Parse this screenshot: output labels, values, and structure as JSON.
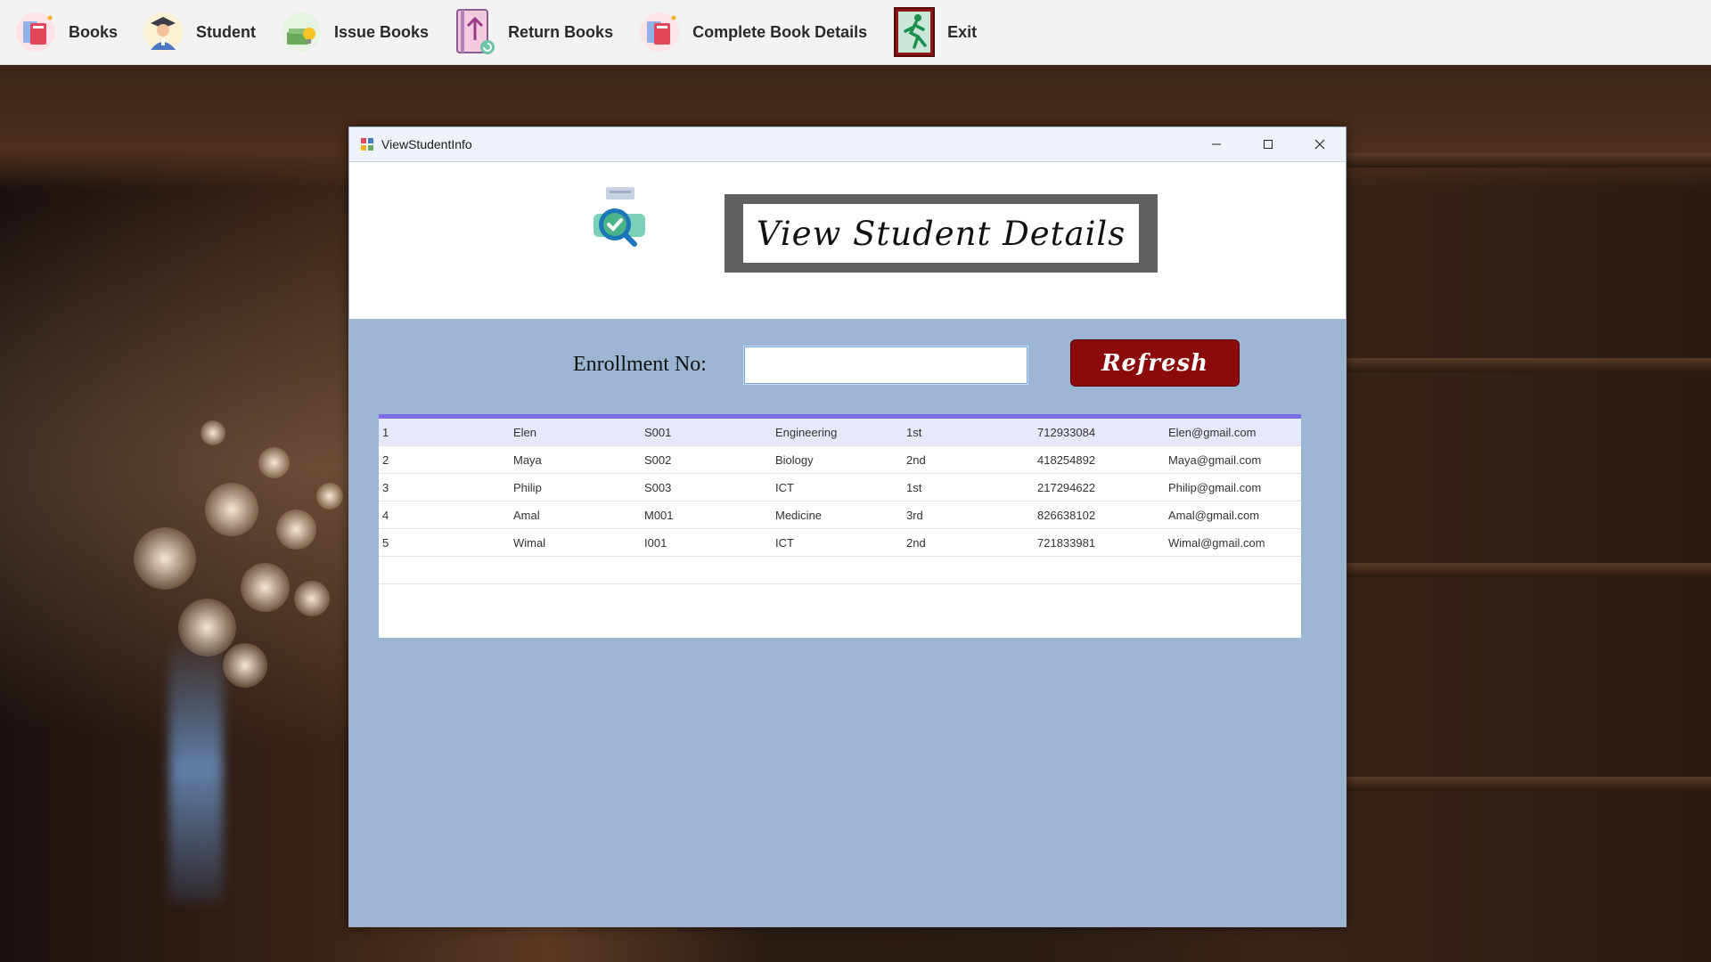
{
  "toolbar": {
    "items": [
      {
        "label": "Books",
        "icon": "books-icon"
      },
      {
        "label": "Student",
        "icon": "student-icon"
      },
      {
        "label": "Issue Books",
        "icon": "issue-books-icon"
      },
      {
        "label": "Return Books",
        "icon": "return-books-icon"
      },
      {
        "label": "Complete Book Details",
        "icon": "book-details-icon"
      },
      {
        "label": "Exit",
        "icon": "exit-icon"
      }
    ]
  },
  "window": {
    "title": "ViewStudentInfo",
    "banner": "View Student Details",
    "enrollment_label": "Enrollment No:",
    "enrollment_value": "",
    "enrollment_placeholder": "",
    "refresh_label": "Refresh"
  },
  "students": {
    "rows": [
      [
        "1",
        "Elen",
        "S001",
        "Engineering",
        "1st",
        "712933084",
        "Elen@gmail.com"
      ],
      [
        "2",
        "Maya",
        "S002",
        "Biology",
        "2nd",
        "418254892",
        "Maya@gmail.com"
      ],
      [
        "3",
        "Philip",
        "S003",
        "ICT",
        "1st",
        "217294622",
        "Philip@gmail.com"
      ],
      [
        "4",
        "Amal",
        "M001",
        "Medicine",
        "3rd",
        "826638102",
        "Amal@gmail.com"
      ],
      [
        "5",
        "Wimal",
        "I001",
        "ICT",
        "2nd",
        "721833981",
        "Wimal@gmail.com"
      ]
    ],
    "selected_row": 0
  },
  "colors": {
    "toolbar_bg": "#f3f3f3",
    "window_body": "#9bb5d3",
    "refresh_button": "#8b0a0a",
    "grid_header_accent": "#7c6ce6",
    "selected_row": "#e8e8fb"
  }
}
